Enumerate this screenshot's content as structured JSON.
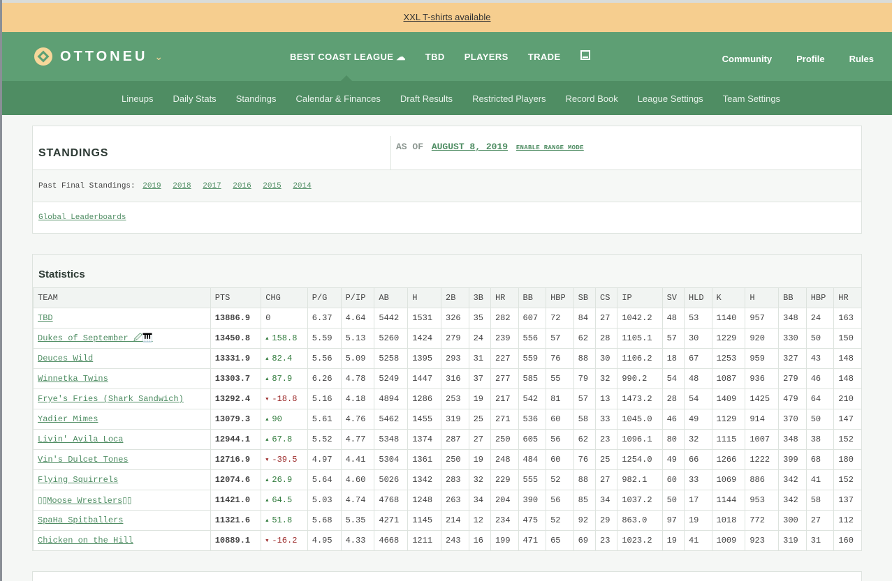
{
  "banner": {
    "text": "XXL T-shirts available"
  },
  "brand": {
    "name": "OTTONEU",
    "chevron": "⌄"
  },
  "nav": {
    "main": [
      "BEST COAST LEAGUE",
      "TBD",
      "PLAYERS",
      "TRADE"
    ],
    "right": [
      "Community",
      "Profile",
      "Rules"
    ]
  },
  "subnav": [
    "Lineups",
    "Daily Stats",
    "Standings",
    "Calendar & Finances",
    "Draft Results",
    "Restricted Players",
    "Record Book",
    "League Settings",
    "Team Settings"
  ],
  "standings": {
    "title": "STANDINGS",
    "as_of_label": "AS OF",
    "as_of_date": "AUGUST 8, 2019",
    "range_mode": "ENABLE RANGE MODE",
    "past_label": "Past Final Standings:",
    "past_years": [
      "2019",
      "2018",
      "2017",
      "2016",
      "2015",
      "2014"
    ],
    "global": "Global Leaderboards"
  },
  "statistics": {
    "title": "Statistics",
    "columns": [
      "TEAM",
      "PTS",
      "CHG",
      "P/G",
      "P/IP",
      "AB",
      "H",
      "2B",
      "3B",
      "HR",
      "BB",
      "HBP",
      "SB",
      "CS",
      "IP",
      "SV",
      "HLD",
      "K",
      "H",
      "BB",
      "HBP",
      "HR"
    ],
    "rows": [
      {
        "team": "TBD",
        "pts": "13886.9",
        "chg": "0",
        "dir": "none",
        "vals": [
          "6.37",
          "4.64",
          "5442",
          "1531",
          "326",
          "35",
          "282",
          "607",
          "72",
          "84",
          "27",
          "1042.2",
          "48",
          "53",
          "1140",
          "957",
          "348",
          "24",
          "163"
        ]
      },
      {
        "team": "Dukes of September 🖉🎹",
        "pts": "13450.8",
        "chg": "158.8",
        "dir": "up",
        "vals": [
          "5.59",
          "5.13",
          "5260",
          "1424",
          "279",
          "24",
          "239",
          "556",
          "57",
          "62",
          "28",
          "1105.1",
          "57",
          "30",
          "1229",
          "920",
          "330",
          "50",
          "150"
        ]
      },
      {
        "team": "Deuces Wild",
        "pts": "13331.9",
        "chg": "82.4",
        "dir": "up",
        "vals": [
          "5.56",
          "5.09",
          "5258",
          "1395",
          "293",
          "31",
          "227",
          "559",
          "76",
          "88",
          "30",
          "1106.2",
          "18",
          "67",
          "1253",
          "959",
          "327",
          "43",
          "148"
        ]
      },
      {
        "team": "Winnetka Twins",
        "pts": "13303.7",
        "chg": "87.9",
        "dir": "up",
        "vals": [
          "6.26",
          "4.78",
          "5249",
          "1447",
          "316",
          "37",
          "277",
          "585",
          "55",
          "79",
          "32",
          "990.2",
          "54",
          "48",
          "1087",
          "936",
          "279",
          "46",
          "148"
        ]
      },
      {
        "team": "Frye's Fries (Shark Sandwich)",
        "pts": "13292.4",
        "chg": "-18.8",
        "dir": "down",
        "vals": [
          "5.16",
          "4.18",
          "4894",
          "1286",
          "253",
          "19",
          "217",
          "542",
          "81",
          "57",
          "13",
          "1473.2",
          "28",
          "54",
          "1409",
          "1425",
          "479",
          "64",
          "210"
        ]
      },
      {
        "team": "Yadier Mimes",
        "pts": "13079.3",
        "chg": "90",
        "dir": "up",
        "vals": [
          "5.61",
          "4.76",
          "5462",
          "1455",
          "319",
          "25",
          "271",
          "536",
          "60",
          "58",
          "33",
          "1045.0",
          "46",
          "49",
          "1129",
          "914",
          "370",
          "50",
          "147"
        ]
      },
      {
        "team": "Livin' Avila Loca",
        "pts": "12944.1",
        "chg": "67.8",
        "dir": "up",
        "vals": [
          "5.52",
          "4.77",
          "5348",
          "1374",
          "287",
          "27",
          "250",
          "605",
          "56",
          "62",
          "23",
          "1096.1",
          "80",
          "32",
          "1115",
          "1007",
          "348",
          "38",
          "152"
        ]
      },
      {
        "team": "Vin's Dulcet Tones",
        "pts": "12716.9",
        "chg": "-39.5",
        "dir": "down",
        "vals": [
          "4.97",
          "4.41",
          "5304",
          "1361",
          "250",
          "19",
          "248",
          "484",
          "60",
          "76",
          "25",
          "1254.0",
          "49",
          "66",
          "1266",
          "1222",
          "399",
          "68",
          "180"
        ]
      },
      {
        "team": "Flying Squirrels",
        "pts": "12074.6",
        "chg": "26.9",
        "dir": "up",
        "vals": [
          "5.64",
          "4.60",
          "5026",
          "1342",
          "283",
          "32",
          "229",
          "555",
          "52",
          "88",
          "27",
          "982.1",
          "60",
          "33",
          "1069",
          "886",
          "342",
          "41",
          "152"
        ]
      },
      {
        "team": "▯▯Moose Wrestlers▯▯",
        "pts": "11421.0",
        "chg": "64.5",
        "dir": "up",
        "vals": [
          "5.03",
          "4.74",
          "4768",
          "1248",
          "263",
          "34",
          "204",
          "390",
          "56",
          "85",
          "34",
          "1037.2",
          "50",
          "17",
          "1144",
          "953",
          "342",
          "58",
          "137"
        ]
      },
      {
        "team": "SpaHa Spitballers",
        "pts": "11321.6",
        "chg": "51.8",
        "dir": "up",
        "vals": [
          "5.68",
          "5.35",
          "4271",
          "1145",
          "214",
          "12",
          "234",
          "475",
          "52",
          "92",
          "29",
          "863.0",
          "97",
          "19",
          "1018",
          "772",
          "300",
          "27",
          "112"
        ]
      },
      {
        "team": "Chicken on the Hill",
        "pts": "10889.1",
        "chg": "-16.2",
        "dir": "down",
        "vals": [
          "4.95",
          "4.33",
          "4668",
          "1211",
          "243",
          "16",
          "199",
          "471",
          "65",
          "69",
          "23",
          "1023.2",
          "19",
          "41",
          "1009",
          "923",
          "319",
          "31",
          "160"
        ]
      }
    ]
  },
  "colors": {
    "header_green": "#5e9f74",
    "subnav_green": "#4f8d63",
    "banner": "#f6ce8f",
    "logo_gold": "#f7d79a"
  }
}
